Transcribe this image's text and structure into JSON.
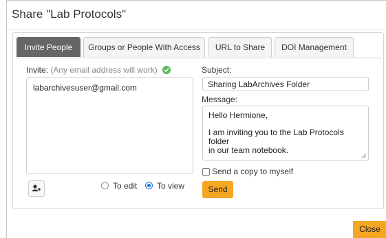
{
  "dialog": {
    "title": "Share \"Lab Protocols\"",
    "close_label": "Close"
  },
  "tabs": [
    {
      "label": "Invite People",
      "active": true
    },
    {
      "label": "Groups or People With Access",
      "active": false
    },
    {
      "label": "URL to Share",
      "active": false
    },
    {
      "label": "DOI Management",
      "active": false
    }
  ],
  "invite": {
    "label": "Invite:",
    "hint": "(Any email address will work)",
    "valid_icon": "check-circle-icon",
    "recipients": "labarchivesuser@gmail.com",
    "add_icon": "add-user-icon"
  },
  "permission": {
    "edit_label": "To edit",
    "view_label": "To view",
    "selected": "To view"
  },
  "subject": {
    "label": "Subject:",
    "value": "Sharing LabArchives Folder"
  },
  "message": {
    "label": "Message:",
    "line1": "Hello Hermione,",
    "line2": "I am inviting you to the Lab Protocols folder",
    "line3": "in our team notebook."
  },
  "copy": {
    "label": "Send a copy to myself",
    "checked": false
  },
  "send_label": "Send",
  "colors": {
    "accent": "#f5a623",
    "active_tab": "#666666",
    "radio": "#1a73e8",
    "valid": "#5cb85c"
  }
}
